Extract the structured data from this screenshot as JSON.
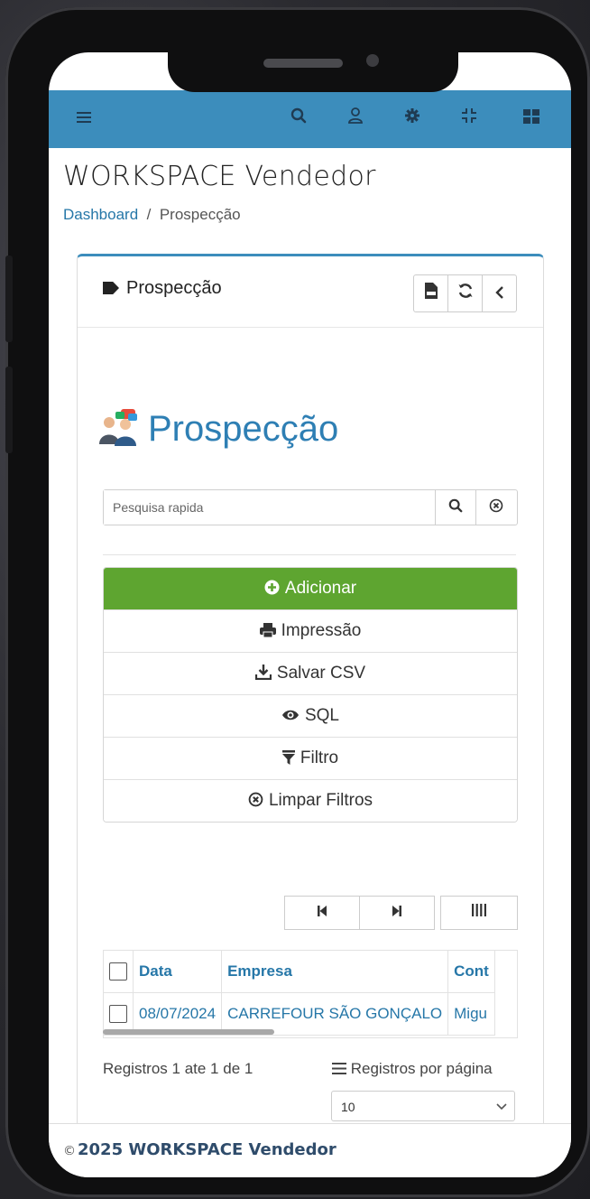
{
  "app": {
    "title": "WORKSPACE Vendedor"
  },
  "topbar": {
    "icons": [
      "menu-icon",
      "search-icon",
      "user-icon",
      "gear-icon",
      "compress-icon",
      "grid-icon"
    ],
    "color": "#3c8dbc"
  },
  "breadcrumb": {
    "home": "Dashboard",
    "separator": "/",
    "current": "Prospecção"
  },
  "panel": {
    "title": "Prospecção",
    "tools": [
      "csv-icon",
      "refresh-icon",
      "chevron-left-icon"
    ]
  },
  "module": {
    "title": "Prospecção"
  },
  "search": {
    "placeholder": "Pesquisa rapida"
  },
  "actions": {
    "add": "Adicionar",
    "print": "Impressão",
    "csv": "Salvar CSV",
    "sql": "SQL",
    "filter": "Filtro",
    "clear": "Limpar Filtros"
  },
  "table": {
    "columns": [
      "Data",
      "Empresa",
      "Cont"
    ],
    "rows": [
      {
        "data": "08/07/2024",
        "empresa": "CARREFOUR SÃO GONÇALO",
        "contato": "Migu"
      }
    ]
  },
  "pagination": {
    "summary": "Registros 1 ate 1 de 1",
    "per_page_label": "Registros por página",
    "per_page_value": "10"
  },
  "footer": {
    "copyright_symbol": "©",
    "text": "2025 WORKSPACE Vendedor"
  }
}
